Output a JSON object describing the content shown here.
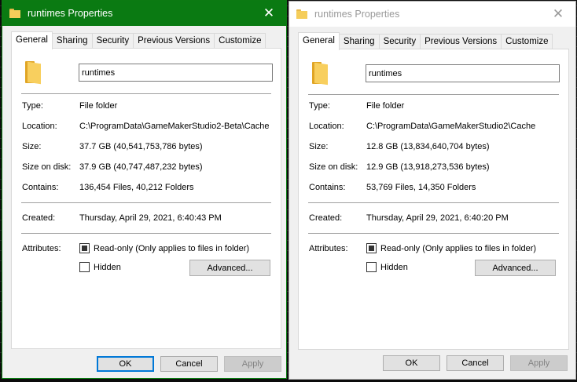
{
  "left": {
    "title": "runtimes Properties",
    "close_glyph": "✕",
    "tabs": [
      "General",
      "Sharing",
      "Security",
      "Previous Versions",
      "Customize"
    ],
    "folder_name": "runtimes",
    "type_label": "Type:",
    "type_value": "File folder",
    "location_label": "Location:",
    "location_value": "C:\\ProgramData\\GameMakerStudio2-Beta\\Cache",
    "size_label": "Size:",
    "size_value": "37.7 GB (40,541,753,786 bytes)",
    "size_disk_label": "Size on disk:",
    "size_disk_value": "37.9 GB (40,747,487,232 bytes)",
    "contains_label": "Contains:",
    "contains_value": "136,454 Files, 40,212 Folders",
    "created_label": "Created:",
    "created_value": "Thursday, April 29, 2021, 6:40:43 PM",
    "attributes_label": "Attributes:",
    "readonly_label": "Read-only (Only applies to files in folder)",
    "hidden_label": "Hidden",
    "advanced_label": "Advanced...",
    "ok_label": "OK",
    "cancel_label": "Cancel",
    "apply_label": "Apply"
  },
  "right": {
    "title": "runtimes Properties",
    "close_glyph": "✕",
    "tabs": [
      "General",
      "Sharing",
      "Security",
      "Previous Versions",
      "Customize"
    ],
    "folder_name": "runtimes",
    "type_label": "Type:",
    "type_value": "File folder",
    "location_label": "Location:",
    "location_value": "C:\\ProgramData\\GameMakerStudio2\\Cache",
    "size_label": "Size:",
    "size_value": "12.8 GB (13,834,640,704 bytes)",
    "size_disk_label": "Size on disk:",
    "size_disk_value": "12.9 GB (13,918,273,536 bytes)",
    "contains_label": "Contains:",
    "contains_value": "53,769 Files, 14,350 Folders",
    "created_label": "Created:",
    "created_value": "Thursday, April 29, 2021, 6:40:20 PM",
    "attributes_label": "Attributes:",
    "readonly_label": "Read-only (Only applies to files in folder)",
    "hidden_label": "Hidden",
    "advanced_label": "Advanced...",
    "ok_label": "OK",
    "cancel_label": "Cancel",
    "apply_label": "Apply"
  },
  "colors": {
    "active_titlebar": "#0a7a12",
    "inactive_titlebar": "#ffffff",
    "dialog_bg": "#f0f0f0",
    "focus_border": "#0078d7"
  }
}
